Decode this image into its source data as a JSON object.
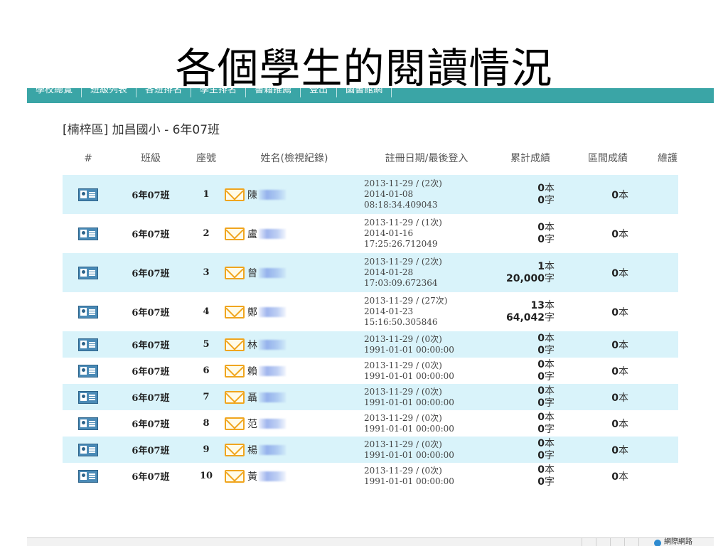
{
  "slide_title": "各個學生的閱讀情況",
  "nav": {
    "items": [
      "學校總覽",
      "班級列表",
      "各班排名",
      "學生排名",
      "書籍推薦",
      "登出",
      "圖書館網"
    ]
  },
  "school_heading": "[楠梓區] 加昌國小 - 6年07班",
  "table": {
    "headers": {
      "num": "#",
      "class": "班級",
      "seat": "座號",
      "name": "姓名(檢視紀錄)",
      "date": "註冊日期/最後登入",
      "total": "累計成績",
      "interval": "區間成績",
      "maintain": "維護"
    },
    "unit_books": "本",
    "unit_chars": "字",
    "rows": [
      {
        "class": "6年07班",
        "seat": "1",
        "name": "陳",
        "reg": "2013-11-29 / (2次)",
        "login_date": "2014-01-08",
        "login_time": "08:18:34.409043",
        "books": "0",
        "chars": "0",
        "interval": "0"
      },
      {
        "class": "6年07班",
        "seat": "2",
        "name": "盧",
        "reg": "2013-11-29 / (1次)",
        "login_date": "2014-01-16",
        "login_time": "17:25:26.712049",
        "books": "0",
        "chars": "0",
        "interval": "0"
      },
      {
        "class": "6年07班",
        "seat": "3",
        "name": "曾",
        "reg": "2013-11-29 / (2次)",
        "login_date": "2014-01-28",
        "login_time": "17:03:09.672364",
        "books": "1",
        "chars": "20,000",
        "interval": "0"
      },
      {
        "class": "6年07班",
        "seat": "4",
        "name": "鄭",
        "reg": "2013-11-29 / (27次)",
        "login_date": "2014-01-23",
        "login_time": "15:16:50.305846",
        "books": "13",
        "chars": "64,042",
        "interval": "0"
      },
      {
        "class": "6年07班",
        "seat": "5",
        "name": "林",
        "reg": "2013-11-29 / (0次)",
        "login_date": "1991-01-01 00:00:00",
        "login_time": "",
        "books": "0",
        "chars": "0",
        "interval": "0"
      },
      {
        "class": "6年07班",
        "seat": "6",
        "name": "賴",
        "reg": "2013-11-29 / (0次)",
        "login_date": "1991-01-01 00:00:00",
        "login_time": "",
        "books": "0",
        "chars": "0",
        "interval": "0"
      },
      {
        "class": "6年07班",
        "seat": "7",
        "name": "聶",
        "reg": "2013-11-29 / (0次)",
        "login_date": "1991-01-01 00:00:00",
        "login_time": "",
        "books": "0",
        "chars": "0",
        "interval": "0"
      },
      {
        "class": "6年07班",
        "seat": "8",
        "name": "范",
        "reg": "2013-11-29 / (0次)",
        "login_date": "1991-01-01 00:00:00",
        "login_time": "",
        "books": "0",
        "chars": "0",
        "interval": "0"
      },
      {
        "class": "6年07班",
        "seat": "9",
        "name": "楊",
        "reg": "2013-11-29 / (0次)",
        "login_date": "1991-01-01 00:00:00",
        "login_time": "",
        "books": "0",
        "chars": "0",
        "interval": "0"
      },
      {
        "class": "6年07班",
        "seat": "10",
        "name": "黃",
        "reg": "2013-11-29 / (0次)",
        "login_date": "1991-01-01 00:00:00",
        "login_time": "",
        "books": "0",
        "chars": "0",
        "interval": "0"
      }
    ]
  },
  "status_bar": {
    "zone_text": "網際網路"
  },
  "colors": {
    "nav_bg": "#3aa5a6",
    "row_highlight": "#d9f3fa",
    "mail_icon": "#f0a51e",
    "card_icon": "#4a8ab6"
  },
  "icons": {
    "record": "student-card-icon",
    "mail": "mail-icon",
    "zone": "globe-icon"
  }
}
